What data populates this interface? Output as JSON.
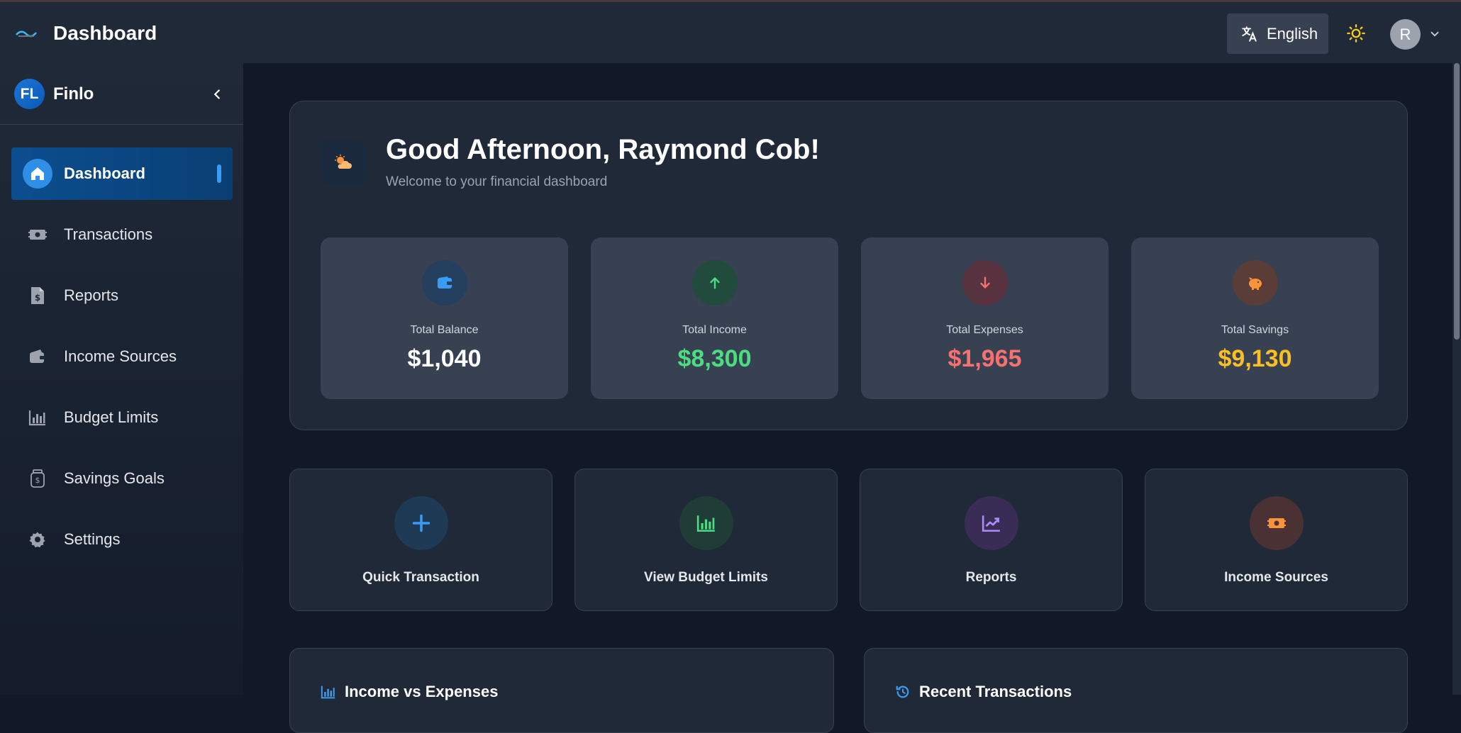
{
  "topbar": {
    "title": "Dashboard",
    "language": "English",
    "avatar_initial": "R"
  },
  "sidebar": {
    "brand_initials": "FL",
    "brand_name": "Finlo",
    "items": [
      {
        "label": "Dashboard",
        "icon": "home-icon",
        "active": true
      },
      {
        "label": "Transactions",
        "icon": "money-icon"
      },
      {
        "label": "Reports",
        "icon": "file-dollar-icon"
      },
      {
        "label": "Income Sources",
        "icon": "wallet-icon"
      },
      {
        "label": "Budget Limits",
        "icon": "bar-chart-icon"
      },
      {
        "label": "Savings Goals",
        "icon": "jar-dollar-icon"
      },
      {
        "label": "Settings",
        "icon": "gear-icon"
      }
    ]
  },
  "welcome": {
    "greeting": "Good Afternoon, Raymond Cob!",
    "subtitle": "Welcome to your financial dashboard"
  },
  "stats": [
    {
      "label": "Total Balance",
      "value": "$1,040",
      "color": "#ffffff",
      "icon": "wallet-icon",
      "accent": "#3b9cf5"
    },
    {
      "label": "Total Income",
      "value": "$8,300",
      "color": "#4ade80",
      "icon": "arrow-up-icon",
      "accent": "#4ade80"
    },
    {
      "label": "Total Expenses",
      "value": "$1,965",
      "color": "#f87171",
      "icon": "arrow-down-icon",
      "accent": "#f87171"
    },
    {
      "label": "Total Savings",
      "value": "$9,130",
      "color": "#fbbf24",
      "icon": "piggy-bank-icon",
      "accent": "#fb923c"
    }
  ],
  "actions": [
    {
      "label": "Quick Transaction",
      "icon": "plus-icon"
    },
    {
      "label": "View Budget Limits",
      "icon": "bar-chart-icon"
    },
    {
      "label": "Reports",
      "icon": "line-chart-icon"
    },
    {
      "label": "Income Sources",
      "icon": "money-icon"
    }
  ],
  "panels": {
    "income_vs_expenses": "Income vs Expenses",
    "recent_transactions": "Recent Transactions"
  }
}
